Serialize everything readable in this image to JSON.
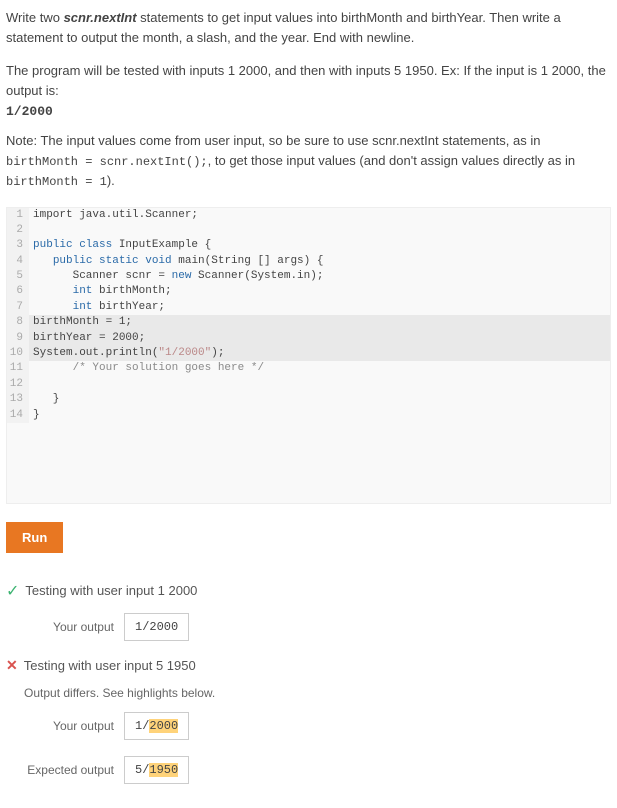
{
  "instructions": {
    "pre": "Write two ",
    "bold": "scnr.nextInt",
    "post": " statements to get input values into birthMonth and birthYear. Then write a statement to output the month, a slash, and the year. End with newline."
  },
  "prog_test": {
    "line1": "The program will be tested with inputs 1 2000, and then with inputs 5 1950. Ex: If the input is 1 2000, the output is:",
    "sample": "1/2000"
  },
  "note": {
    "pre": "Note: The input values come from user input, so be sure to use scnr.nextInt statements, as in ",
    "code1": "birthMonth = scnr.nextInt();",
    "mid": ", to get those input values (and don't assign values directly as in ",
    "code2": "birthMonth = 1",
    "post": ")."
  },
  "code_lines": [
    {
      "n": "1",
      "html": "<span class='imp'>import</span> java.util.Scanner;",
      "hl": false
    },
    {
      "n": "2",
      "html": "",
      "hl": false
    },
    {
      "n": "3",
      "html": "<span class='kw'>public class</span> InputExample {",
      "hl": false
    },
    {
      "n": "4",
      "html": "   <span class='kw'>public static void</span> main(String [] args) {",
      "hl": false
    },
    {
      "n": "5",
      "html": "      Scanner scnr = <span class='kw'>new</span> Scanner(System.in);",
      "hl": false
    },
    {
      "n": "6",
      "html": "      <span class='typ'>int</span> birthMonth;",
      "hl": false
    },
    {
      "n": "7",
      "html": "      <span class='typ'>int</span> birthYear;",
      "hl": false
    },
    {
      "n": "8",
      "html": "birthMonth = 1;",
      "hl": true
    },
    {
      "n": "9",
      "html": "birthYear = 2000;",
      "hl": true
    },
    {
      "n": "10",
      "html": "System.out.println(<span class='str'>\"1/2000\"</span>);",
      "hl": true
    },
    {
      "n": "11",
      "html": "      <span class='cmt'>/* Your solution goes here */</span>",
      "hl": false
    },
    {
      "n": "12",
      "html": "",
      "hl": false
    },
    {
      "n": "13",
      "html": "   }",
      "hl": false
    },
    {
      "n": "14",
      "html": "}",
      "hl": false
    }
  ],
  "run_label": "Run",
  "test1": {
    "label": "Testing with user input 1 2000",
    "your_output_label": "Your output",
    "your_output": "1/2000"
  },
  "test2": {
    "label": "Testing with user input 5 1950",
    "diff_msg": "Output differs. See highlights below.",
    "your_output_label": "Your output",
    "your_output_pre": "1/",
    "your_output_hl": "2000",
    "expected_label": "Expected output",
    "expected_pre": "5/",
    "expected_hl": "1950"
  }
}
